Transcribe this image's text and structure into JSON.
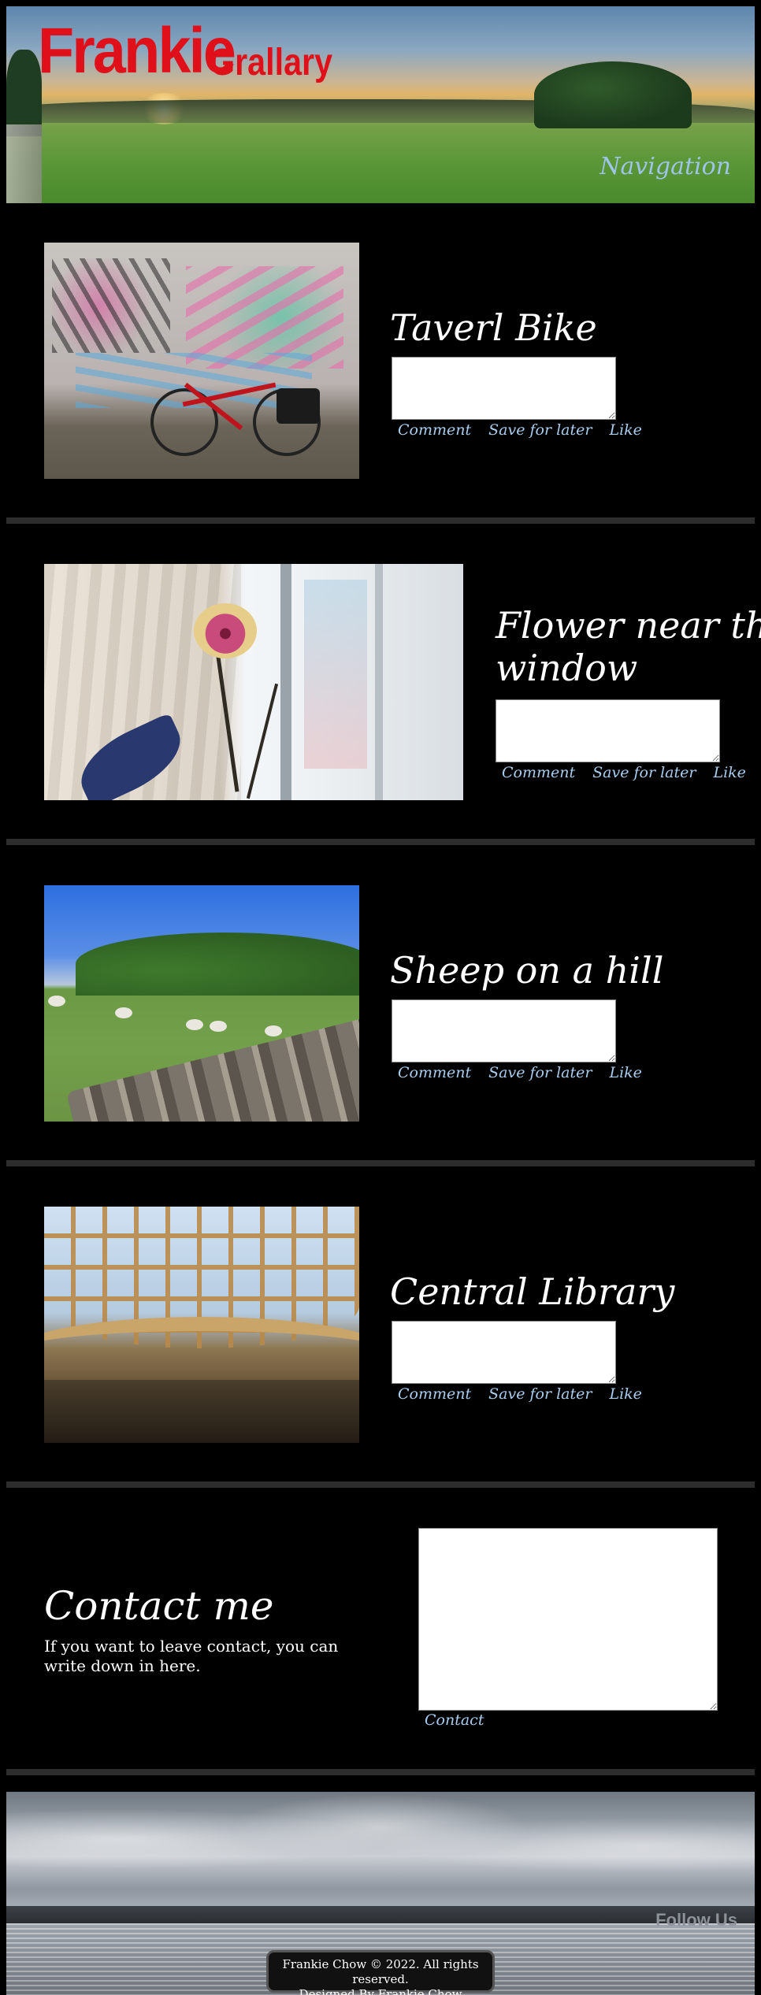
{
  "header": {
    "logo_main": "Frankie",
    "logo_sub": "Grallary",
    "nav_label": "Navigation"
  },
  "posts": [
    {
      "title": "Taverl Bike",
      "actions": [
        "Comment",
        "Save for later",
        "Like"
      ]
    },
    {
      "title_line1": "Flower near the",
      "title_line2": "window",
      "actions": [
        "Comment",
        "Save for later",
        "Like"
      ]
    },
    {
      "title": "Sheep on a hill",
      "actions": [
        "Comment",
        "Save for later",
        "Like"
      ]
    },
    {
      "title": "Central Library",
      "actions": [
        "Comment",
        "Save for later",
        "Like"
      ]
    }
  ],
  "contact": {
    "heading": "Contact me",
    "text": "If you want to leave contact, you can write down in here.",
    "link": "Contact"
  },
  "footer": {
    "follow": "Follow Us",
    "copyright": "Frankie Chow © 2022. All rights reserved.",
    "designer": "Designed By Frankie Chow"
  }
}
